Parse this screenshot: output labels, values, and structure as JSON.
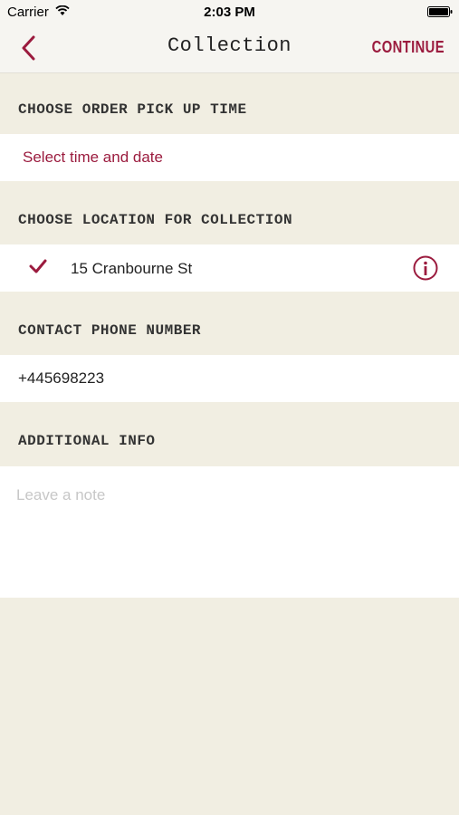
{
  "status_bar": {
    "carrier": "Carrier",
    "time": "2:03 PM",
    "icons": [
      "wifi-icon",
      "battery-icon"
    ]
  },
  "nav": {
    "title": "Collection",
    "continue_label": "CONTINUE",
    "back_icon": "chevron-left-icon"
  },
  "sections": {
    "pickup": {
      "header": "CHOOSE ORDER PICK UP TIME",
      "value": "Select time and date"
    },
    "location": {
      "header": "CHOOSE LOCATION FOR COLLECTION",
      "value": "15 Cranbourne St",
      "selected": true,
      "icons": [
        "checkmark-icon",
        "info-icon"
      ]
    },
    "phone": {
      "header": "CONTACT PHONE NUMBER",
      "value": "+445698223"
    },
    "info": {
      "header": "ADDITIONAL INFO",
      "placeholder": "Leave a note"
    }
  },
  "colors": {
    "accent": "#9b1b3e",
    "background": "#f1eee2",
    "row": "#ffffff"
  }
}
